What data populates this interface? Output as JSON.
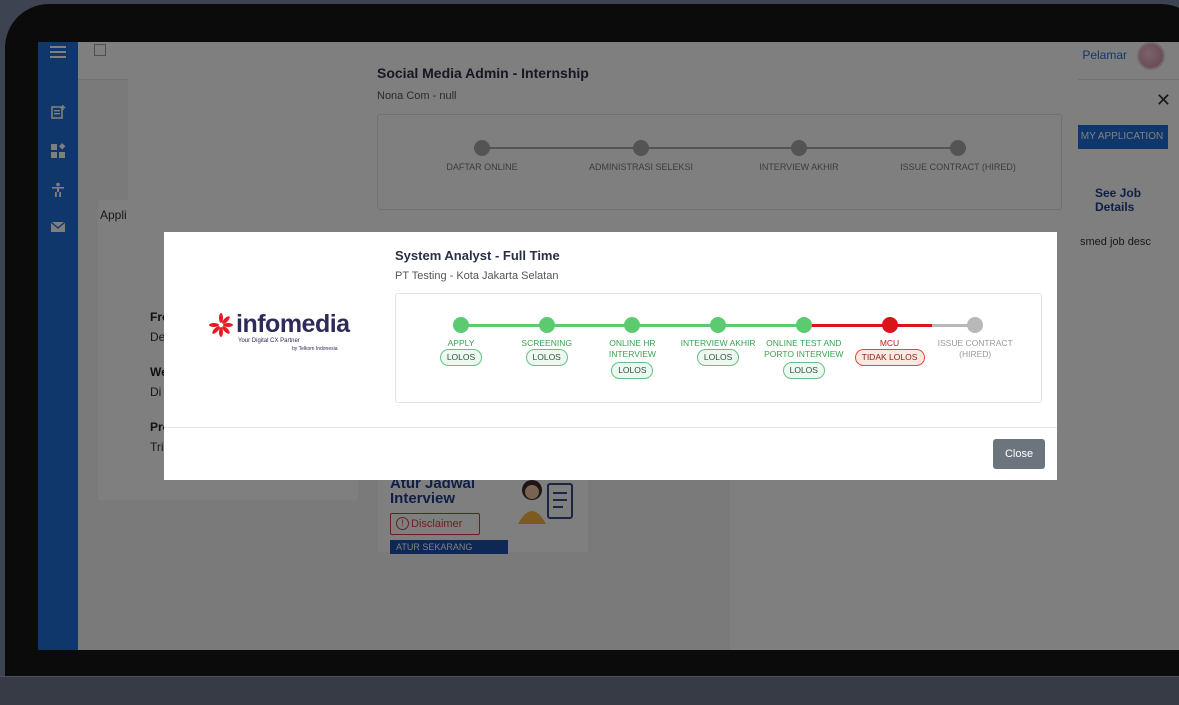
{
  "topbar": {
    "user_label": "Pelamar"
  },
  "background": {
    "applications_label": "Appli",
    "form_lines": [
      "Fro",
      "De",
      "We",
      "Di",
      "Pro",
      "Tri"
    ],
    "promo_title": "Atur Jadwal Interview",
    "disclaimer_label": "Disclaimer",
    "atur_button_label": "ATUR SEKARANG",
    "right_panel": {
      "button_label": "MY APPLICATION",
      "link_label": "See Job Details",
      "desc": "smed job desc"
    }
  },
  "back_modal": {
    "title": "Social Media Admin - Internship",
    "subtitle": "Nona Com - null",
    "steps": [
      "DAFTAR ONLINE",
      "ADMINISTRASI SELEKSI",
      "INTERVIEW AKHIR",
      "ISSUE CONTRACT (HIRED)"
    ]
  },
  "front_modal": {
    "logo": {
      "name": "infomedia",
      "tagline": "Your Digital CX Partner",
      "by": "by Telkom Indonesia"
    },
    "title": "System Analyst - Full Time",
    "subtitle": "PT Testing - Kota Jakarta Selatan",
    "steps": [
      {
        "label": "APPLY",
        "status": "LOLOS",
        "state": "pass"
      },
      {
        "label": "SCREENING",
        "status": "LOLOS",
        "state": "pass"
      },
      {
        "label": "ONLINE HR INTERVIEW",
        "status": "LOLOS",
        "state": "pass"
      },
      {
        "label": "INTERVIEW AKHIR",
        "status": "LOLOS",
        "state": "pass"
      },
      {
        "label": "ONLINE TEST AND PORTO INTERVIEW",
        "status": "LOLOS",
        "state": "pass"
      },
      {
        "label": "MCU",
        "status": "TIDAK LOLOS",
        "state": "fail"
      },
      {
        "label": "ISSUE CONTRACT (HIRED)",
        "status": "",
        "state": "pending"
      }
    ],
    "close_label": "Close"
  },
  "colors": {
    "pass": "#5ccb6f",
    "fail": "#d9141a",
    "pending": "#b8b8b8",
    "pass_text": "#3aa24f",
    "fail_text": "#c81414",
    "pending_text": "#999999",
    "primary": "#1f6fd8"
  },
  "icons": [
    "menu-icon",
    "document-add-icon",
    "dashboard-icon",
    "accessibility-icon",
    "mail-icon",
    "close-icon",
    "info-burst-icon"
  ]
}
